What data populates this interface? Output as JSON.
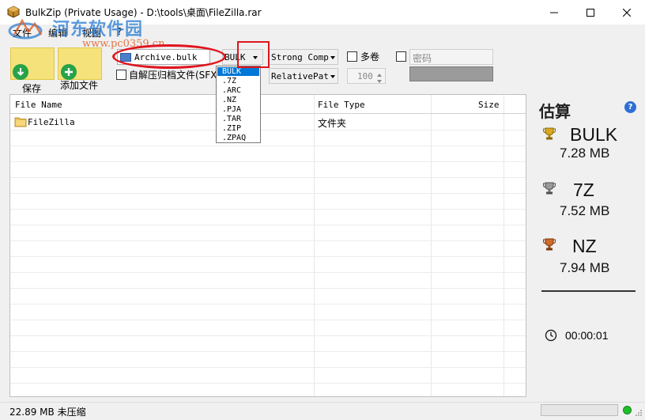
{
  "window": {
    "title": "BulkZip (Private Usage)  - D:\\tools\\桌面\\FileZilla.rar"
  },
  "watermark": {
    "title": "河东软件园",
    "url": "www.pc0359.cn"
  },
  "menu": {
    "items": [
      "文件",
      "编辑",
      "视图",
      "?"
    ]
  },
  "toolbar": {
    "save_label": "保存",
    "add_files_label": "添加文件"
  },
  "options": {
    "archive_name": "Archive.bulk",
    "format": "BULK",
    "compression": "Strong Comp",
    "path_mode": "RelativePat",
    "sfx_label": "自解压归档文件(SFX)",
    "multivolume_label": "多卷",
    "password_label": "密码",
    "volume_size": "100"
  },
  "format_dropdown": {
    "items": [
      "BULK",
      ".7Z",
      ".ARC",
      ".NZ",
      ".PJA",
      ".TAR",
      ".ZIP",
      ".ZPAQ"
    ],
    "selected_index": 0
  },
  "file_list": {
    "columns": [
      "File Name",
      "File Type",
      "Size"
    ],
    "rows": [
      {
        "name": "FileZilla",
        "type": "文件夹",
        "size": ""
      }
    ]
  },
  "estimate": {
    "title": "估算",
    "items": [
      {
        "format": "BULK",
        "size": "7.28 MB",
        "medal": "gold"
      },
      {
        "format": "7Z",
        "size": "7.52 MB",
        "medal": "silver"
      },
      {
        "format": "NZ",
        "size": "7.94 MB",
        "medal": "bronze"
      }
    ],
    "time": "00:00:01"
  },
  "status": {
    "text": "22.89 MB 未压缩"
  },
  "colors": {
    "accent_blue": "#0078d7",
    "toolbar_yellow": "#f5e27a",
    "annotation_red": "#e0141e",
    "ok_green": "#1fbf2a"
  }
}
